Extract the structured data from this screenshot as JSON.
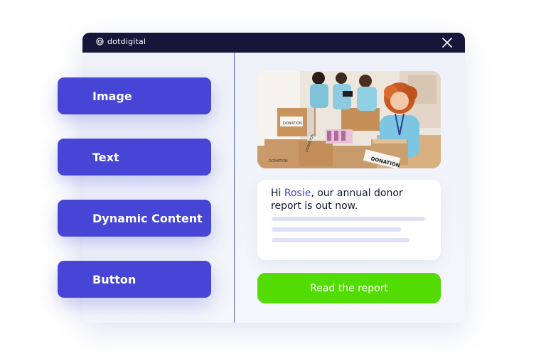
{
  "window": {
    "brand_name": "dotdigital",
    "close_icon": "close-icon"
  },
  "blocks": [
    {
      "label": "Image"
    },
    {
      "label": "Text"
    },
    {
      "label": "Dynamic Content"
    },
    {
      "label": "Button"
    }
  ],
  "preview": {
    "image_alt": "Volunteers packing donation boxes",
    "box_labels": [
      "DONATION",
      "DONATION",
      "DONATION",
      "DONATION"
    ],
    "greeting_prefix": "Hi ",
    "name": "Rosie",
    "greeting_suffix": ", our annual donor report is out now.",
    "cta_label": "Read the report"
  },
  "colors": {
    "titlebar": "#15173a",
    "block": "#4645d6",
    "highlight": "#4645d6",
    "cta": "#53dc03",
    "divider": "#5964c9"
  }
}
